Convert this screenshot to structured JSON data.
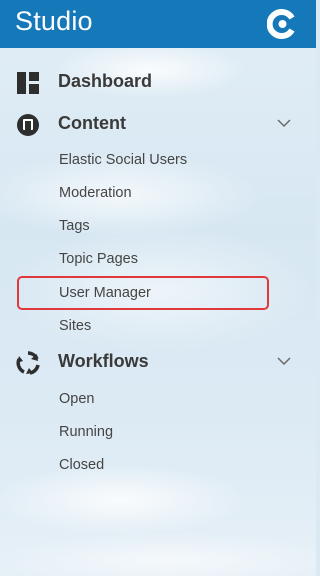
{
  "header": {
    "title": "Studio",
    "logo_icon": "coremedia-logo-icon",
    "background": "#1478b9"
  },
  "nav": {
    "dashboard": {
      "label": "Dashboard",
      "icon": "dashboard-icon"
    },
    "content": {
      "label": "Content",
      "icon": "content-icon",
      "expanded": true,
      "items": [
        {
          "label": "Elastic Social Users"
        },
        {
          "label": "Moderation"
        },
        {
          "label": "Tags"
        },
        {
          "label": "Topic Pages"
        },
        {
          "label": "User Manager",
          "highlighted": true
        },
        {
          "label": "Sites"
        }
      ]
    },
    "workflows": {
      "label": "Workflows",
      "icon": "workflows-icon",
      "expanded": true,
      "items": [
        {
          "label": "Open"
        },
        {
          "label": "Running"
        },
        {
          "label": "Closed"
        }
      ]
    }
  },
  "highlight_color": "#e0393b"
}
